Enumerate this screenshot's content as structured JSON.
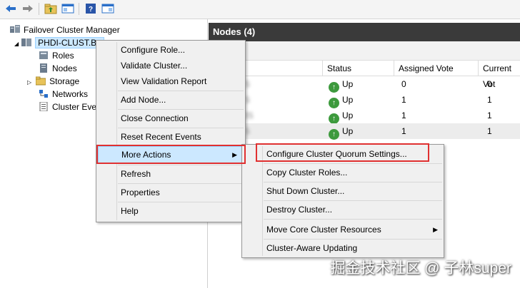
{
  "toolbar": {
    "buttons": [
      "back-icon",
      "forward-icon",
      "up-folder-icon",
      "show-hide-tree-icon",
      "help-icon",
      "show-action-pane-icon"
    ]
  },
  "tree": {
    "root": "Failover Cluster Manager",
    "cluster": "PHDI-CLUST.Ba",
    "items": [
      "Roles",
      "Nodes",
      "Storage",
      "Networks",
      "Cluster Eve"
    ]
  },
  "nodes_panel": {
    "title": "Nodes (4)",
    "columns": [
      "Status",
      "Assigned Vote",
      "Current Vot"
    ],
    "rows": [
      {
        "name": "S",
        "status": "Up",
        "assigned_vote": "0",
        "current_vote": "0"
      },
      {
        "name": "S",
        "status": "Up",
        "assigned_vote": "1",
        "current_vote": "1"
      },
      {
        "name": "3S",
        "status": "Up",
        "assigned_vote": "1",
        "current_vote": "1"
      },
      {
        "name": "S",
        "status": "Up",
        "assigned_vote": "1",
        "current_vote": "1"
      }
    ]
  },
  "context_menu": {
    "items": [
      "Configure Role...",
      "Validate Cluster...",
      "View Validation Report",
      "Add Node...",
      "Close Connection",
      "Reset Recent Events",
      "More Actions",
      "Refresh",
      "Properties",
      "Help"
    ]
  },
  "submenu": {
    "items": [
      "Configure Cluster Quorum Settings...",
      "Copy Cluster Roles...",
      "Shut Down Cluster...",
      "Destroy Cluster...",
      "Move Core Cluster Resources",
      "Cluster-Aware Updating"
    ]
  },
  "watermark": "掘金技术社区 @ 子林super",
  "colors": {
    "highlight": "#cce8ff",
    "header_bg": "#3a3a3a",
    "callout_red": "#e03030",
    "status_green": "#3d9a3d"
  }
}
